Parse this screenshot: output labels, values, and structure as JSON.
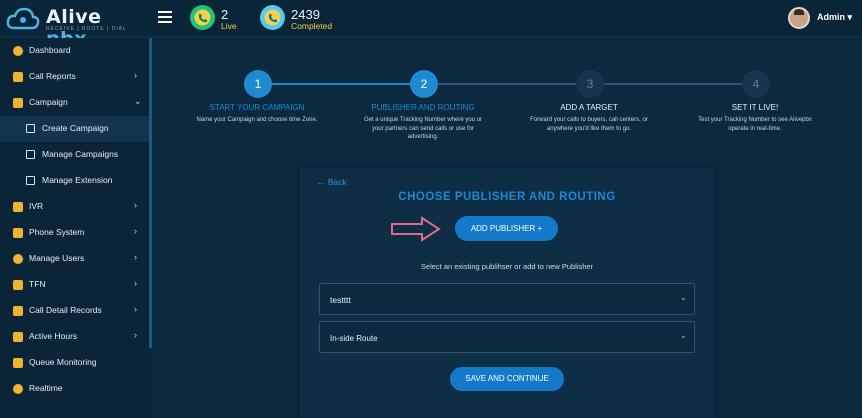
{
  "brand": {
    "name_a": "Alive",
    "name_b": "pbx",
    "tagline": "RECEIVE | ROUTE | DIAL"
  },
  "header": {
    "live_count": "2",
    "live_label": "Live",
    "completed_count": "2439",
    "completed_label": "Completed",
    "user_label": "Admin"
  },
  "sidebar": {
    "items": [
      {
        "label": "Dashboard",
        "icon": "clock-icon"
      },
      {
        "label": "Call Reports",
        "icon": "phone-gear-icon"
      },
      {
        "label": "Campaign",
        "icon": "megaphone-icon"
      },
      {
        "label": "Create Campaign",
        "icon": "copy-icon"
      },
      {
        "label": "Manage Campaigns",
        "icon": "copy-icon"
      },
      {
        "label": "Manage Extension",
        "icon": "copy-icon"
      },
      {
        "label": "IVR",
        "icon": "phone-tree-icon"
      },
      {
        "label": "Phone System",
        "icon": "phone-system-icon"
      },
      {
        "label": "Manage Users",
        "icon": "user-icon"
      },
      {
        "label": "TFN",
        "icon": "list-icon"
      },
      {
        "label": "Call Detail Records",
        "icon": "record-icon"
      },
      {
        "label": "Active Hours",
        "icon": "hours-icon"
      },
      {
        "label": "Queue Monitoring",
        "icon": "monitor-icon"
      },
      {
        "label": "Realtime",
        "icon": "clock-icon"
      }
    ]
  },
  "steps": [
    {
      "num": "1",
      "title": "START YOUR CAMPAIGN",
      "desc": "Name your Campaign and choose time Zone."
    },
    {
      "num": "2",
      "title": "PUBLISHER AND ROUTING",
      "desc": "Get a unique Tracking Number where you or your partners can send calls or use for advertising."
    },
    {
      "num": "3",
      "title": "ADD A TARGET",
      "desc": "Forward your calls to buyers, call centers, or anywhere you'd like them to go."
    },
    {
      "num": "4",
      "title": "SET IT LIVE!",
      "desc": "Test your Tracking Number to see Alivepbx operate in real-time."
    }
  ],
  "card": {
    "back_label": "← Back",
    "title": "CHOOSE PUBLISHER AND ROUTING",
    "add_publisher_label": "ADD PUBLISHER +",
    "hint": "Select an existing publihser or add to new Publisher",
    "publisher_value": "testttt",
    "route_value": "In-side Route",
    "save_label": "SAVE AND CONTINUE"
  },
  "colors": {
    "accent": "#1f8ad0",
    "background": "#0b2a40",
    "arrow": "#e06a8c",
    "icon": "#f0b334"
  }
}
